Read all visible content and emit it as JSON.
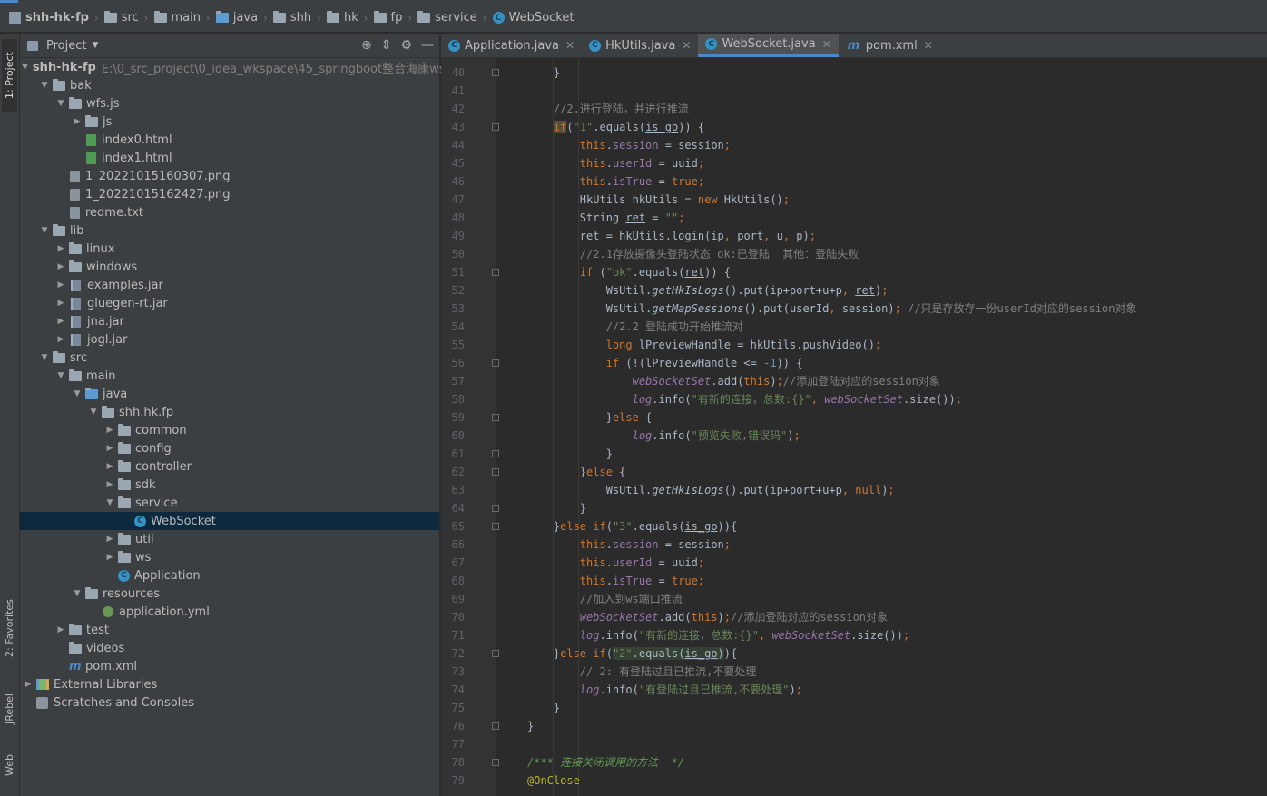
{
  "breadcrumb": {
    "items": [
      "shh-hk-fp",
      "src",
      "main",
      "java",
      "shh",
      "hk",
      "fp",
      "service",
      "WebSocket"
    ]
  },
  "left_strip": {
    "project_tab": "1: Project",
    "favorites_tab": "2: Favorites",
    "jrebel_tab": "JRebel",
    "web_tab": "Web"
  },
  "project_panel": {
    "title": "Project",
    "root_name": "shh-hk-fp",
    "root_path": "E:\\0_src_project\\0_idea_wkspace\\45_springboot整合海康ws推流",
    "tree": [
      {
        "label": "bak"
      },
      {
        "label": "wfs.js"
      },
      {
        "label": "js"
      },
      {
        "label": "index0.html"
      },
      {
        "label": "index1.html"
      },
      {
        "label": "1_20221015160307.png"
      },
      {
        "label": "1_20221015162427.png"
      },
      {
        "label": "redme.txt"
      },
      {
        "label": "lib"
      },
      {
        "label": "linux"
      },
      {
        "label": "windows"
      },
      {
        "label": "examples.jar"
      },
      {
        "label": "gluegen-rt.jar"
      },
      {
        "label": "jna.jar"
      },
      {
        "label": "jogl.jar"
      },
      {
        "label": "src"
      },
      {
        "label": "main"
      },
      {
        "label": "java"
      },
      {
        "label": "shh.hk.fp"
      },
      {
        "label": "common"
      },
      {
        "label": "config"
      },
      {
        "label": "controller"
      },
      {
        "label": "sdk"
      },
      {
        "label": "service"
      },
      {
        "label": "WebSocket"
      },
      {
        "label": "util"
      },
      {
        "label": "ws"
      },
      {
        "label": "Application"
      },
      {
        "label": "resources"
      },
      {
        "label": "application.yml"
      },
      {
        "label": "test"
      },
      {
        "label": "videos"
      },
      {
        "label": "pom.xml"
      },
      {
        "label": "External Libraries"
      },
      {
        "label": "Scratches and Consoles"
      }
    ]
  },
  "editor_tabs": [
    {
      "label": "Application.java",
      "active": false
    },
    {
      "label": "HkUtils.java",
      "active": false
    },
    {
      "label": "WebSocket.java",
      "active": true
    },
    {
      "label": "pom.xml",
      "active": false
    }
  ],
  "code": {
    "line_numbers": [
      "40",
      "41",
      "42",
      "43",
      "44",
      "45",
      "46",
      "47",
      "48",
      "49",
      "50",
      "51",
      "52",
      "53",
      "54",
      "55",
      "56",
      "57",
      "58",
      "59",
      "60",
      "61",
      "62",
      "63",
      "64",
      "65",
      "66",
      "67",
      "68",
      "69",
      "70",
      "71",
      "72",
      "73",
      "74",
      "75",
      "76",
      "77",
      "78",
      "79"
    ],
    "literals": {
      "s1": "\"1\"",
      "s_empty": "\"\"",
      "s_ok": "\"ok\"",
      "s_new_conn": "\"有新的连接，总数:{}\"",
      "s_preview_fail": "\"预览失败,错误码\"",
      "s3": "\"3\"",
      "s2": "\"2\"",
      "s_logged": "\"有登陆过且已推流,不要处理\"",
      "n_minus1": "-1"
    },
    "comments": {
      "c42": "//2.进行登陆，并进行推流",
      "c50": "//2.1存放摄像头登陆状态 ok:已登陆  其他：登陆失败",
      "c53": "//只是存放存一份userId对应的session对象",
      "c54": "//2.2 登陆成功开始推流对",
      "c57": "//添加登陆对应的session对象",
      "c69": "//加入到ws端口推流",
      "c70": "//添加登陆对应的session对象",
      "c73": "// 2: 有登陆过且已推流,不要处理",
      "c78": "/*** 连接关闭调用的方法  */"
    },
    "annotation79": "@OnClose"
  },
  "colors": {
    "editor_bg": "#2b2b2b",
    "panel_bg": "#3c3f41",
    "selection": "#0d293e",
    "keyword": "#cc7832",
    "string": "#6a8759",
    "comment": "#808080",
    "field": "#9876aa",
    "number": "#6897bb",
    "accent": "#4a88c7"
  }
}
